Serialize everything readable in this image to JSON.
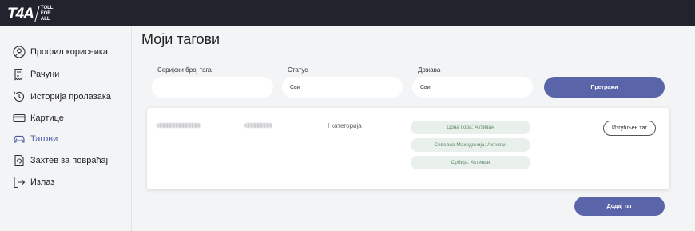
{
  "logo": {
    "main": "T4A",
    "sub1": "TOLL",
    "sub2": "FOR",
    "sub3": "ALL"
  },
  "sidebar": {
    "items": [
      {
        "label": "Профил корисника",
        "icon": "user-icon"
      },
      {
        "label": "Рачуни",
        "icon": "receipt-icon"
      },
      {
        "label": "Историја пролазака",
        "icon": "history-icon"
      },
      {
        "label": "Картице",
        "icon": "card-icon"
      },
      {
        "label": "Тагови",
        "icon": "car-icon",
        "active": true
      },
      {
        "label": "Захтев за повраћај",
        "icon": "refund-icon"
      },
      {
        "label": "Излаз",
        "icon": "logout-icon"
      }
    ]
  },
  "page": {
    "title": "Моји тагови"
  },
  "filters": {
    "serial_label": "Серијски број тага",
    "serial_value": "",
    "status_label": "Статус",
    "status_value": "Сви",
    "country_label": "Држава",
    "country_value": "Сви",
    "search_button": "Претражи"
  },
  "tag": {
    "category": "I категорија",
    "statuses": [
      "Црна Гора: Активан",
      "Северна Македонија: Активан",
      "Србија: Активан"
    ],
    "lost_button": "Изгубљен таг"
  },
  "add_button": "Додај таг",
  "colors": {
    "accent": "#5a64a8",
    "topbar": "#22232c",
    "status_bg": "#e9efea",
    "status_text": "#5a8a66"
  }
}
